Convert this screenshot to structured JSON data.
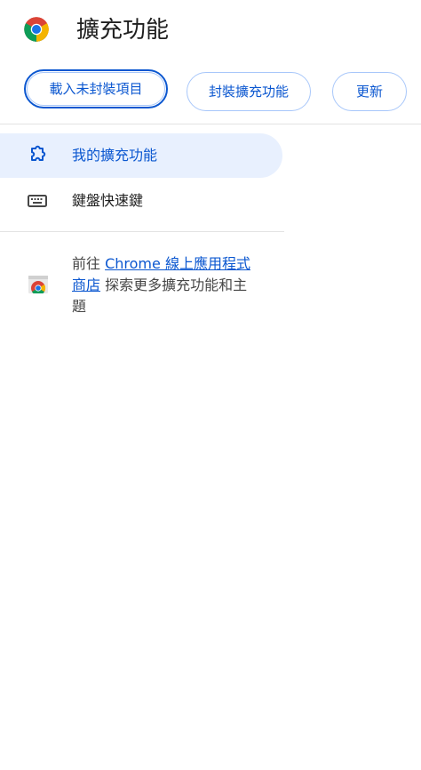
{
  "header": {
    "title": "擴充功能"
  },
  "toolbar": {
    "load_unpacked": "載入未封裝項目",
    "pack_extension": "封裝擴充功能",
    "update": "更新"
  },
  "sidebar": {
    "items": [
      {
        "label": "我的擴充功能",
        "icon": "extension-puzzle-icon",
        "active": true
      },
      {
        "label": "鍵盤快速鍵",
        "icon": "keyboard-icon",
        "active": false
      }
    ]
  },
  "store_promo": {
    "prefix": "前往 ",
    "link_text": "Chrome 線上應用程式商店",
    "suffix": " 探索更多擴充功能和主題",
    "icon": "chrome-web-store-icon"
  },
  "colors": {
    "accent": "#0b57d0",
    "active_bg": "#e8f0fe",
    "button_border": "#a8c7fa"
  }
}
